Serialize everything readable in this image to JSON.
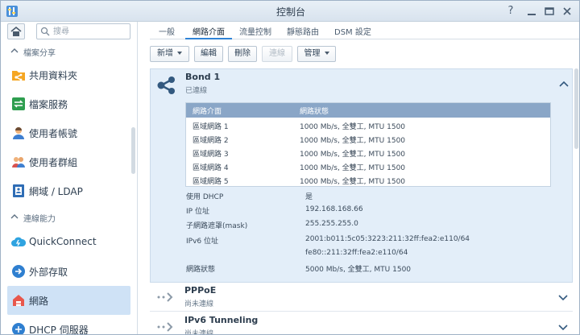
{
  "window": {
    "title": "控制台"
  },
  "sidebar": {
    "search_placeholder": "搜尋",
    "sections": [
      {
        "label": "檔案分享"
      },
      {
        "label": "連線能力"
      }
    ],
    "items": [
      {
        "label": "共用資料夾"
      },
      {
        "label": "檔案服務"
      },
      {
        "label": "使用者帳號"
      },
      {
        "label": "使用者群組"
      },
      {
        "label": "網域 / LDAP"
      },
      {
        "label": "QuickConnect"
      },
      {
        "label": "外部存取"
      },
      {
        "label": "網路"
      },
      {
        "label": "DHCP 伺服器"
      }
    ]
  },
  "tabs": [
    {
      "label": "一般"
    },
    {
      "label": "網路介面"
    },
    {
      "label": "流量控制"
    },
    {
      "label": "靜態路由"
    },
    {
      "label": "DSM 設定"
    }
  ],
  "toolbar": {
    "create": "新增",
    "edit": "編輯",
    "delete": "刪除",
    "connect": "連線",
    "manage": "管理"
  },
  "interfaces": {
    "bond": {
      "name": "Bond 1",
      "status": "已連線",
      "table_headers": [
        "網路介面",
        "網路狀態"
      ],
      "members": [
        {
          "name": "區域網路 1",
          "status": "1000 Mb/s, 全雙工, MTU 1500"
        },
        {
          "name": "區域網路 2",
          "status": "1000 Mb/s, 全雙工, MTU 1500"
        },
        {
          "name": "區域網路 3",
          "status": "1000 Mb/s, 全雙工, MTU 1500"
        },
        {
          "name": "區域網路 4",
          "status": "1000 Mb/s, 全雙工, MTU 1500"
        },
        {
          "name": "區域網路 5",
          "status": "1000 Mb/s, 全雙工, MTU 1500"
        }
      ],
      "props": [
        {
          "label": "使用 DHCP",
          "value": "是"
        },
        {
          "label": "IP 位址",
          "value": "192.168.168.66"
        },
        {
          "label": "子網路遮罩(mask)",
          "value": "255.255.255.0"
        },
        {
          "label": "IPv6 位址",
          "value": "2001:b011:5c05:3223:211:32ff:fea2:e110/64"
        },
        {
          "label": "",
          "value": "fe80::211:32ff:fea2:e110/64"
        },
        {
          "label": "網路狀態",
          "value": "5000 Mb/s, 全雙工, MTU 1500"
        }
      ]
    },
    "pppoe": {
      "name": "PPPoE",
      "status": "尚未連線"
    },
    "ipv6tunnel": {
      "name": "IPv6 Tunneling",
      "status": "尚未連線"
    }
  },
  "colors": {
    "accent": "#2f83d6",
    "selected_bg": "#cfe2f6",
    "table_header": "#8aa6c7"
  }
}
